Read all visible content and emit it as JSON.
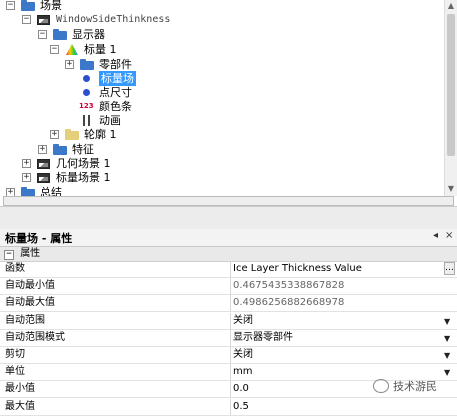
{
  "tree": {
    "root": "场景",
    "window": "WindowSideThinkness",
    "display": "显示器",
    "scalar": "标量 1",
    "parts": "零部件",
    "scalar_field": "标量场",
    "point_size": "点尺寸",
    "color_bar": "颜色条",
    "color_bar_icon": "123",
    "animation": "动画",
    "outline": "轮廓 1",
    "features": "特征",
    "geometry_scene": "几何场景 1",
    "scalar_scene": "标量场景 1",
    "summary": "总结"
  },
  "panel": {
    "title": "标量场 - 属性",
    "pin_label": "◂",
    "close_label": "×",
    "group": "属性"
  },
  "properties": [
    {
      "name": "函数",
      "value": "Ice Layer Thickness Value",
      "widget": "dots"
    },
    {
      "name": "自动最小值",
      "value": "0.4675435338867828",
      "widget": "none",
      "gray": true
    },
    {
      "name": "自动最大值",
      "value": "0.4986256882668978",
      "widget": "none",
      "gray": true
    },
    {
      "name": "自动范围",
      "value": "关闭",
      "widget": "dropdown"
    },
    {
      "name": "自动范围模式",
      "value": "显示器零部件",
      "widget": "dropdown"
    },
    {
      "name": "剪切",
      "value": "关闭",
      "widget": "dropdown"
    },
    {
      "name": "单位",
      "value": "mm",
      "widget": "dropdown"
    },
    {
      "name": "最小值",
      "value": "0.0",
      "widget": "none"
    },
    {
      "name": "最大值",
      "value": "0.5",
      "widget": "none"
    }
  ],
  "watermark": "技术游民"
}
